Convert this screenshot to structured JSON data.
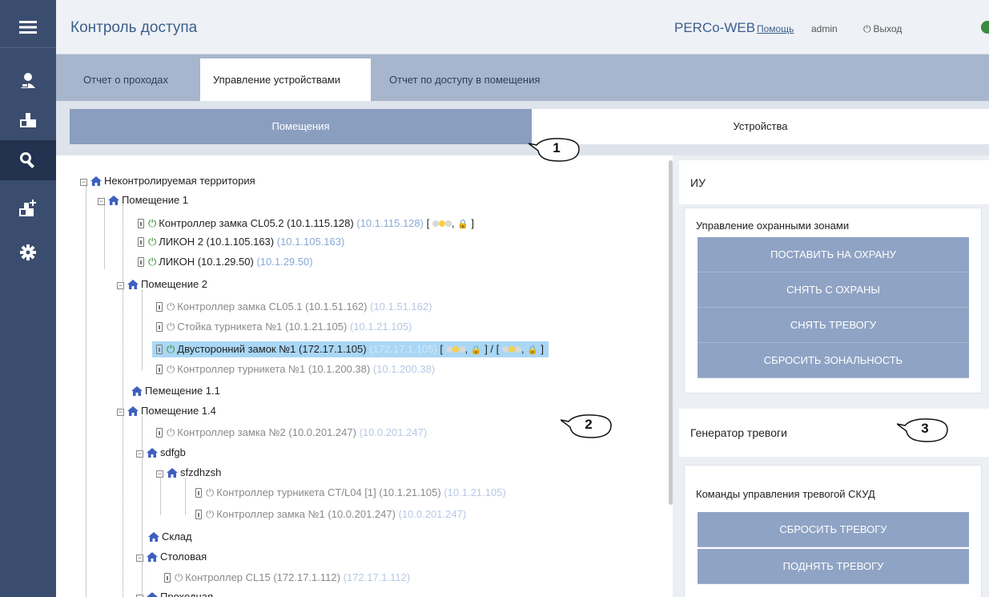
{
  "sidebar": {
    "items": [
      {
        "icon": "menu-icon"
      },
      {
        "icon": "employee-icon"
      },
      {
        "icon": "access-icon"
      },
      {
        "icon": "search-icon"
      },
      {
        "icon": "add-access-icon"
      },
      {
        "icon": "settings-icon"
      }
    ]
  },
  "header": {
    "title": "Контроль доступа",
    "brand": "PERCo-WEB",
    "help": "Помощь",
    "user": "admin",
    "logout": "Выход"
  },
  "tabs": [
    {
      "label": "Отчет о проходах"
    },
    {
      "label": "Управление устройствами"
    },
    {
      "label": "Отчет по доступу в помещения"
    }
  ],
  "subtabs": [
    {
      "label": "Помещения"
    },
    {
      "label": "Устройства"
    }
  ],
  "callouts": [
    "1",
    "2",
    "3"
  ],
  "tree": {
    "root": "Неконтролируемая территория",
    "room1": "Помещение 1",
    "dev1": {
      "name": "Контроллер замка CL05.2 (10.1.115.128)",
      "ip": "(10.1.115.128)",
      "status": "[ ",
      "status_end": ", ",
      "status_close": " ]"
    },
    "dev2": {
      "name": "ЛИКОН 2 (10.1.105.163)",
      "ip": "(10.1.105.163)"
    },
    "dev3": {
      "name": "ЛИКОН (10.1.29.50)",
      "ip": "(10.1.29.50)"
    },
    "room2": "Помещение 2",
    "dev4": {
      "name": "Контроллер замка CL05.1 (10.1.51.162)",
      "ip": "(10.1.51.162)"
    },
    "dev5": {
      "name": "Стойка турникета №1 (10.1.21.105)",
      "ip": "(10.1.21.105)"
    },
    "dev6": {
      "name": "Двусторонний замок №1 (172.17.1.105)",
      "ip": "(172.17.1.105)",
      "status": "[ ",
      "sep": " ] / [ ",
      "status_close": " ]"
    },
    "dev7": {
      "name": "Контроллер турникета №1 (10.1.200.38)",
      "ip": "(10.1.200.38)"
    },
    "room11": "Пемещение 1.1",
    "room14": "Помещение 1.4",
    "dev8": {
      "name": "Контроллер замка №2 (10.0.201.247)",
      "ip": "(10.0.201.247)"
    },
    "sdfgb": "sdfgb",
    "sfzdhzsh": "sfzdhzsh",
    "dev9": {
      "name": "Контроллер турникета CT/L04 [1] (10.1.21.105)",
      "ip": "(10.1.21.105)"
    },
    "dev10": {
      "name": "Контроллер замка №1 (10.0.201.247)",
      "ip": "(10.0.201.247)"
    },
    "sklad": "Склад",
    "stolovaya": "Столовая",
    "dev11": {
      "name": "Контроллер CL15 (172.17.1.112)",
      "ip": "(172.17.1.112)"
    },
    "cut": "Проходная"
  },
  "iu": {
    "title": "ИУ",
    "card_title": "Управление охранными зонами",
    "buttons": [
      "ПОСТАВИТЬ НА ОХРАНУ",
      "СНЯТЬ С ОХРАНЫ",
      "СНЯТЬ ТРЕВОГУ",
      "СБРОСИТЬ ЗОНАЛЬНОСТЬ"
    ]
  },
  "alarm": {
    "title": "Генератор тревоги",
    "card_title": "Команды управления тревогой СКУД",
    "buttons": [
      "СБРОСИТЬ ТРЕВОГУ",
      "ПОДНЯТЬ ТРЕВОГУ"
    ]
  },
  "colors": {
    "sidebar": "#3b4d6e",
    "tab_bar": "#a7b6cc",
    "button": "#8fa3c4",
    "ip_text": "#8aaad6",
    "highlight": "#a9d7f5",
    "power_on": "#2a8a2e"
  }
}
